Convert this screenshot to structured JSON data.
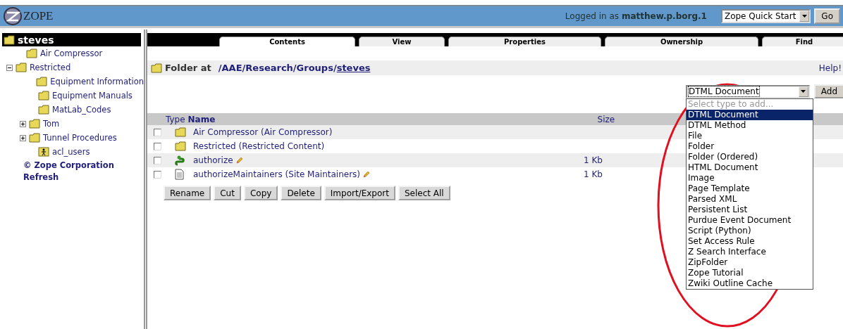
{
  "header": {
    "logo_text": "ZOPE",
    "login": "Logged in as **matthew.p.borg.1**",
    "quick_start": "Zope Quick Start",
    "go_button": "Go"
  },
  "sidebar": {
    "root": "steves",
    "items": [
      {
        "label": "Air Compressor",
        "kind": "folder",
        "has_children": false,
        "expanded": false
      },
      {
        "label": "Restricted",
        "kind": "folder",
        "has_children": true,
        "expanded": true,
        "children": [
          {
            "label": "Equipment Information",
            "kind": "folder",
            "has_children": false,
            "expanded": false
          },
          {
            "label": "Equipment Manuals",
            "kind": "folder",
            "has_children": false,
            "expanded": false
          },
          {
            "label": "MatLab_Codes",
            "kind": "folder",
            "has_children": false,
            "expanded": false
          },
          {
            "label": "Tom",
            "kind": "folder",
            "has_children": true,
            "expanded": false
          },
          {
            "label": "Tunnel Procedures",
            "kind": "folder",
            "has_children": true,
            "expanded": false
          },
          {
            "label": "acl_users",
            "kind": "user-folder",
            "has_children": false,
            "expanded": false
          }
        ]
      }
    ],
    "links": [
      "© Zope Corporation",
      "Refresh"
    ]
  },
  "tabs": [
    {
      "label": "Contents",
      "selected": true
    },
    {
      "label": "View",
      "selected": false
    },
    {
      "label": "Properties",
      "selected": false
    },
    {
      "label": "Ownership",
      "selected": false
    },
    {
      "label": "Find",
      "selected": false
    }
  ],
  "location": {
    "label": "Folder at",
    "path": [
      {
        "sep": "/",
        "name": "AAE",
        "current": false
      },
      {
        "sep": "/",
        "name": "Research",
        "current": false
      },
      {
        "sep": "/",
        "name": "Groups",
        "current": false
      },
      {
        "sep": "/",
        "name": "steves",
        "current": true
      }
    ],
    "help": "Help!"
  },
  "add": {
    "value": "DTML Document",
    "button": "Add",
    "first_option": "Select type to add...",
    "options": [
      {
        "label": "DTML Document",
        "selected": true
      },
      {
        "label": "DTML Method",
        "selected": false
      },
      {
        "label": "File",
        "selected": false
      },
      {
        "label": "Folder",
        "selected": false
      },
      {
        "label": "Folder (Ordered)",
        "selected": false
      },
      {
        "label": "HTML Document",
        "selected": false
      },
      {
        "label": "Image",
        "selected": false
      },
      {
        "label": "Page Template",
        "selected": false
      },
      {
        "label": "Parsed XML",
        "selected": false
      },
      {
        "label": "Persistent List",
        "selected": false
      },
      {
        "label": "Purdue Event Document",
        "selected": false
      },
      {
        "label": "Script (Python)",
        "selected": false
      },
      {
        "label": "Set Access Rule",
        "selected": false
      },
      {
        "label": "Z Search Interface",
        "selected": false
      },
      {
        "label": "ZipFolder",
        "selected": false
      },
      {
        "label": "Zope Tutorial",
        "selected": false
      },
      {
        "label": "Zwiki Outline Cache",
        "selected": false
      }
    ]
  },
  "table": {
    "columns": [
      "Type",
      "Name",
      "Size"
    ],
    "rows": [
      {
        "checked": false,
        "kind": "folder",
        "name": "Air Compressor (Air Compressor)",
        "editable": false
      },
      {
        "checked": false,
        "kind": "folder",
        "name": "Restricted (Restricted Content)",
        "editable": false
      },
      {
        "checked": false,
        "kind": "script",
        "name": "authorize",
        "size": "1 Kb",
        "editable": true
      },
      {
        "checked": false,
        "kind": "document",
        "name": "authorizeMaintainers (Site Maintainers)",
        "size": "1 Kb",
        "editable": true
      }
    ]
  },
  "buttons": [
    "Rename",
    "Cut",
    "Copy",
    "Delete",
    "Import/Export",
    "Select All"
  ]
}
